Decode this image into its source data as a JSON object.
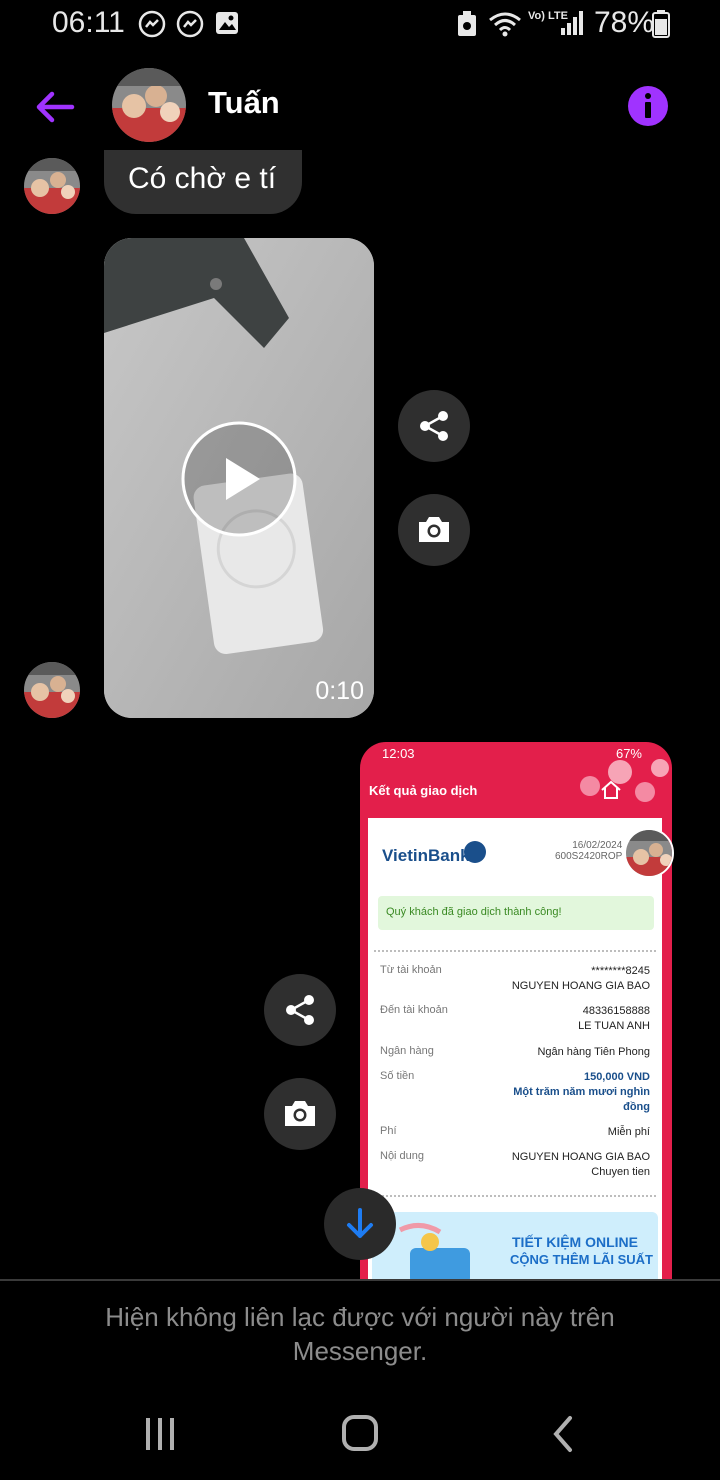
{
  "status_bar": {
    "time": "06:11",
    "battery": "78%",
    "network": "Vo) LTE"
  },
  "header": {
    "contact_name": "Tuấn",
    "accent_color": "#a033ff"
  },
  "messages": {
    "text_bubble": "Có chờ e tí",
    "video_duration": "0:10"
  },
  "receipt": {
    "status_time": "12:03",
    "status_battery": "67%",
    "title": "Kết quả giao dịch",
    "bank_logo": "VietinBank",
    "date": "16/02/2024",
    "ref": "600S2420ROP",
    "success_message": "Quý khách đã giao dịch thành công!",
    "rows": [
      {
        "label": "Từ tài khoản",
        "value": "********8245",
        "value2": "NGUYEN HOANG GIA BAO"
      },
      {
        "label": "Đến tài khoản",
        "value": "48336158888",
        "value2": "LE TUAN ANH"
      },
      {
        "label": "Ngân hàng",
        "value": "Ngân hàng Tiên Phong",
        "value2": ""
      },
      {
        "label": "Số tiền",
        "value": "150,000 VND",
        "value2": "Một trăm năm mươi nghìn đồng"
      },
      {
        "label": "Phí",
        "value": "Miễn phí",
        "value2": ""
      },
      {
        "label": "Nội dung",
        "value": "NGUYEN HOANG GIA BAO",
        "value2": "Chuyen tien"
      }
    ],
    "promo_line1": "TIẾT KIỆM ONLINE",
    "promo_line2": "CỘNG THÊM LÃI SUẤT"
  },
  "footer": {
    "notice": "Hiện không liên lạc được với người này trên Messenger."
  },
  "icons": {
    "back": "back-arrow-icon",
    "info": "info-icon",
    "share": "share-icon",
    "camera": "camera-icon",
    "play": "play-icon",
    "scroll_down": "arrow-down-icon"
  }
}
